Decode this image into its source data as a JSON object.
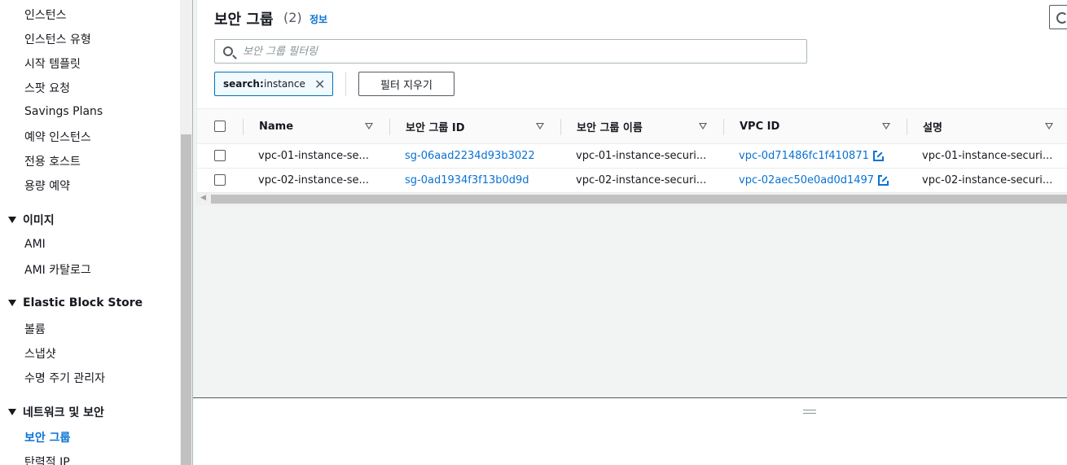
{
  "sidebar": {
    "items": [
      {
        "label": "인스턴스"
      },
      {
        "label": "인스턴스 유형"
      },
      {
        "label": "시작 템플릿"
      },
      {
        "label": "스팟 요청"
      },
      {
        "label": "Savings Plans"
      },
      {
        "label": "예약 인스턴스"
      },
      {
        "label": "전용 호스트"
      },
      {
        "label": "용량 예약"
      }
    ],
    "images_section": {
      "title": "이미지",
      "items": [
        {
          "label": "AMI"
        },
        {
          "label": "AMI 카탈로그"
        }
      ]
    },
    "ebs_section": {
      "title": "Elastic Block Store",
      "items": [
        {
          "label": "볼륨"
        },
        {
          "label": "스냅샷"
        },
        {
          "label": "수명 주기 관리자"
        }
      ]
    },
    "network_section": {
      "title": "네트워크 및 보안",
      "items": [
        {
          "label": "보안 그룹"
        },
        {
          "label": "탄력적 IP"
        }
      ]
    }
  },
  "header": {
    "title": "보안 그룹",
    "count": "(2)",
    "info_label": "정보"
  },
  "search": {
    "placeholder": "보안 그룹 필터링",
    "value": ""
  },
  "filter_token": {
    "key": "search:",
    "value": "instance"
  },
  "clear_filters_label": "필터 지우기",
  "table": {
    "columns": [
      "Name",
      "보안 그룹 ID",
      "보안 그룹 이름",
      "VPC ID",
      "설명"
    ],
    "rows": [
      {
        "name": "vpc-01-instance-se...",
        "sg_id": "sg-06aad2234d93b3022",
        "sg_name": "vpc-01-instance-securi...",
        "vpc_id": "vpc-0d71486fc1f410871",
        "description": "vpc-01-instance-securi..."
      },
      {
        "name": "vpc-02-instance-se...",
        "sg_id": "sg-0ad1934f3f13b0d9d",
        "sg_name": "vpc-02-instance-securi...",
        "vpc_id": "vpc-02aec50e0ad0d1497",
        "description": "vpc-02-instance-securi..."
      }
    ]
  },
  "colors": {
    "link": "#0972d3",
    "text": "#16191f",
    "token_border": "#0073bb",
    "panel_bg": "#f2f3f3"
  }
}
